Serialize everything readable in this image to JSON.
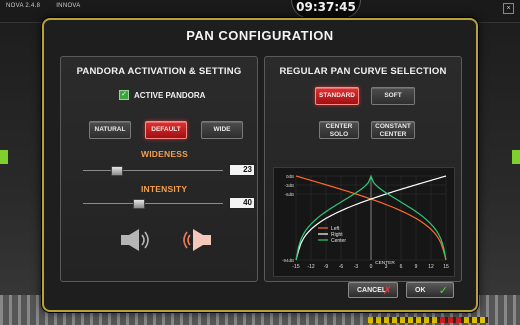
{
  "app": {
    "title_left": "NOVA 2.4.8",
    "title_right": "INNOVA",
    "clock": "09:37:45",
    "close_glyph": "×"
  },
  "dialog": {
    "title": "PAN CONFIGURATION",
    "pandora": {
      "title": "PANDORA ACTIVATION & SETTING",
      "active_label": "ACTIVE PANDORA",
      "active_checked": true,
      "modes": [
        "NATURAL",
        "DEFAULT",
        "WIDE"
      ],
      "selected_mode": "DEFAULT",
      "wideness": {
        "label": "WIDENESS",
        "value": "23"
      },
      "intensity": {
        "label": "INTENSITY",
        "value": "40"
      }
    },
    "pan_curve": {
      "title": "REGULAR PAN CURVE SELECTION",
      "options": [
        {
          "label": "STANDARD",
          "active": true
        },
        {
          "label": "SOFT",
          "active": false
        },
        {
          "label_line1": "CENTER",
          "label_line2": "SOLO",
          "active": false
        },
        {
          "label_line1": "CONSTANT",
          "label_line2": "CENTER",
          "active": false
        }
      ]
    },
    "footer": {
      "cancel_label": "CANCEL",
      "cancel_glyph": "✗",
      "ok_label": "OK",
      "ok_glyph": "✓"
    }
  },
  "chart_data": {
    "type": "line",
    "x": [
      -15,
      -12,
      -9,
      -6,
      -3,
      0,
      3,
      6,
      9,
      12,
      15
    ],
    "xlabel_center": "CENTER",
    "y_tick_labels": [
      "0dB",
      "-3dB",
      "-6dB",
      "-94dB"
    ],
    "series": [
      {
        "name": "Left",
        "color": "#ff6a2a"
      },
      {
        "name": "Right",
        "color": "#ffffff"
      },
      {
        "name": "Center",
        "color": "#2ec87a"
      }
    ],
    "legend_position": "center"
  }
}
